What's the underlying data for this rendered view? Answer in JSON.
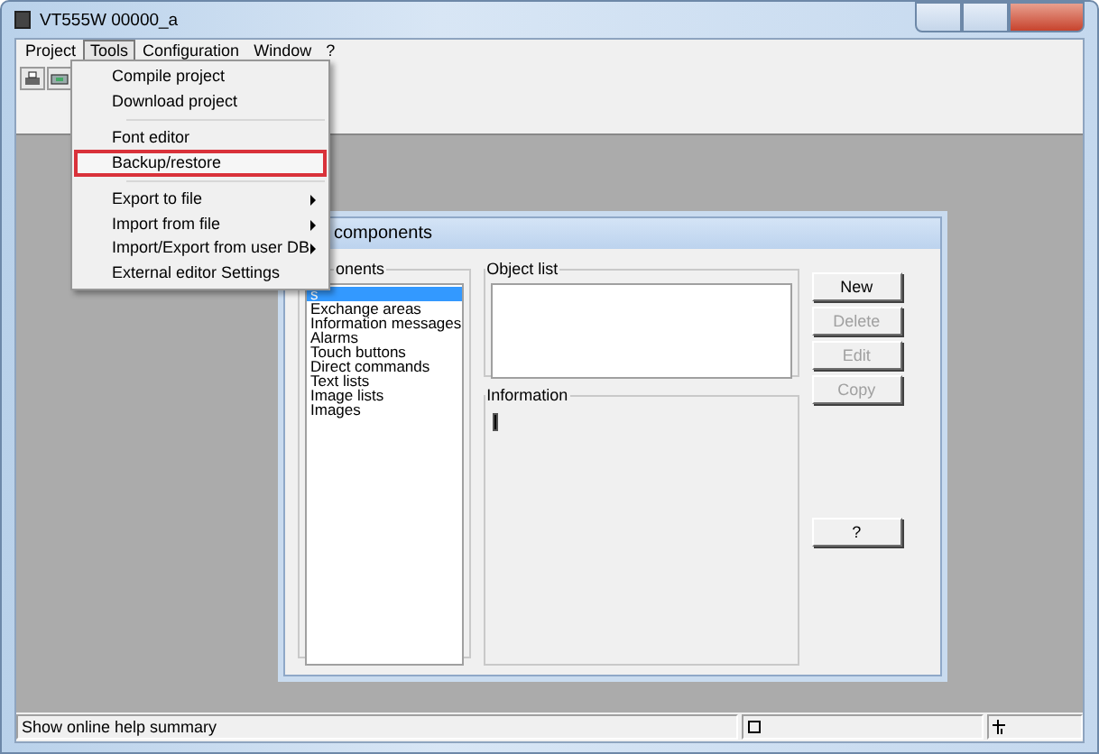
{
  "window": {
    "title": "VT555W 00000_a"
  },
  "menu_bar": [
    {
      "label": "Project",
      "selected": false
    },
    {
      "label": "Tools",
      "selected": true
    },
    {
      "label": "Configuration",
      "selected": false
    },
    {
      "label": "Window",
      "selected": false
    },
    {
      "label": "?",
      "selected": false
    }
  ],
  "tools_menu": [
    {
      "kind": "item",
      "label": "Compile project",
      "highlighted": false,
      "submenu": false
    },
    {
      "kind": "item",
      "label": "Download project",
      "highlighted": false,
      "submenu": false
    },
    {
      "kind": "separator"
    },
    {
      "kind": "item",
      "label": "Font editor",
      "highlighted": false,
      "submenu": false
    },
    {
      "kind": "item",
      "label": "Backup/restore",
      "highlighted": true,
      "submenu": false
    },
    {
      "kind": "separator"
    },
    {
      "kind": "item",
      "label": "Export to file",
      "highlighted": false,
      "submenu": true
    },
    {
      "kind": "item",
      "label": "Import from file",
      "highlighted": false,
      "submenu": true
    },
    {
      "kind": "item",
      "label": "Import/Export from user DB",
      "highlighted": false,
      "submenu": true
    },
    {
      "kind": "item",
      "label": "External editor Settings",
      "highlighted": false,
      "submenu": false
    }
  ],
  "dialog": {
    "title": "components",
    "components": {
      "label": "onents",
      "items": [
        {
          "label": "s",
          "selected": true
        },
        {
          "label": "Exchange areas",
          "selected": false
        },
        {
          "label": "Information messages",
          "selected": false
        },
        {
          "label": "Alarms",
          "selected": false
        },
        {
          "label": "Touch buttons",
          "selected": false
        },
        {
          "label": "Direct commands",
          "selected": false
        },
        {
          "label": "Text lists",
          "selected": false
        },
        {
          "label": "Image lists",
          "selected": false
        },
        {
          "label": "Images",
          "selected": false
        }
      ]
    },
    "object_list": {
      "label": "Object list"
    },
    "information": {
      "label": "Information"
    },
    "buttons": [
      {
        "label": "New",
        "disabled": false
      },
      {
        "label": "Delete",
        "disabled": true
      },
      {
        "label": "Edit",
        "disabled": true
      },
      {
        "label": "Copy",
        "disabled": true
      },
      {
        "label": "?",
        "disabled": false
      }
    ]
  },
  "status_bar": {
    "text": "Show online help summary"
  }
}
